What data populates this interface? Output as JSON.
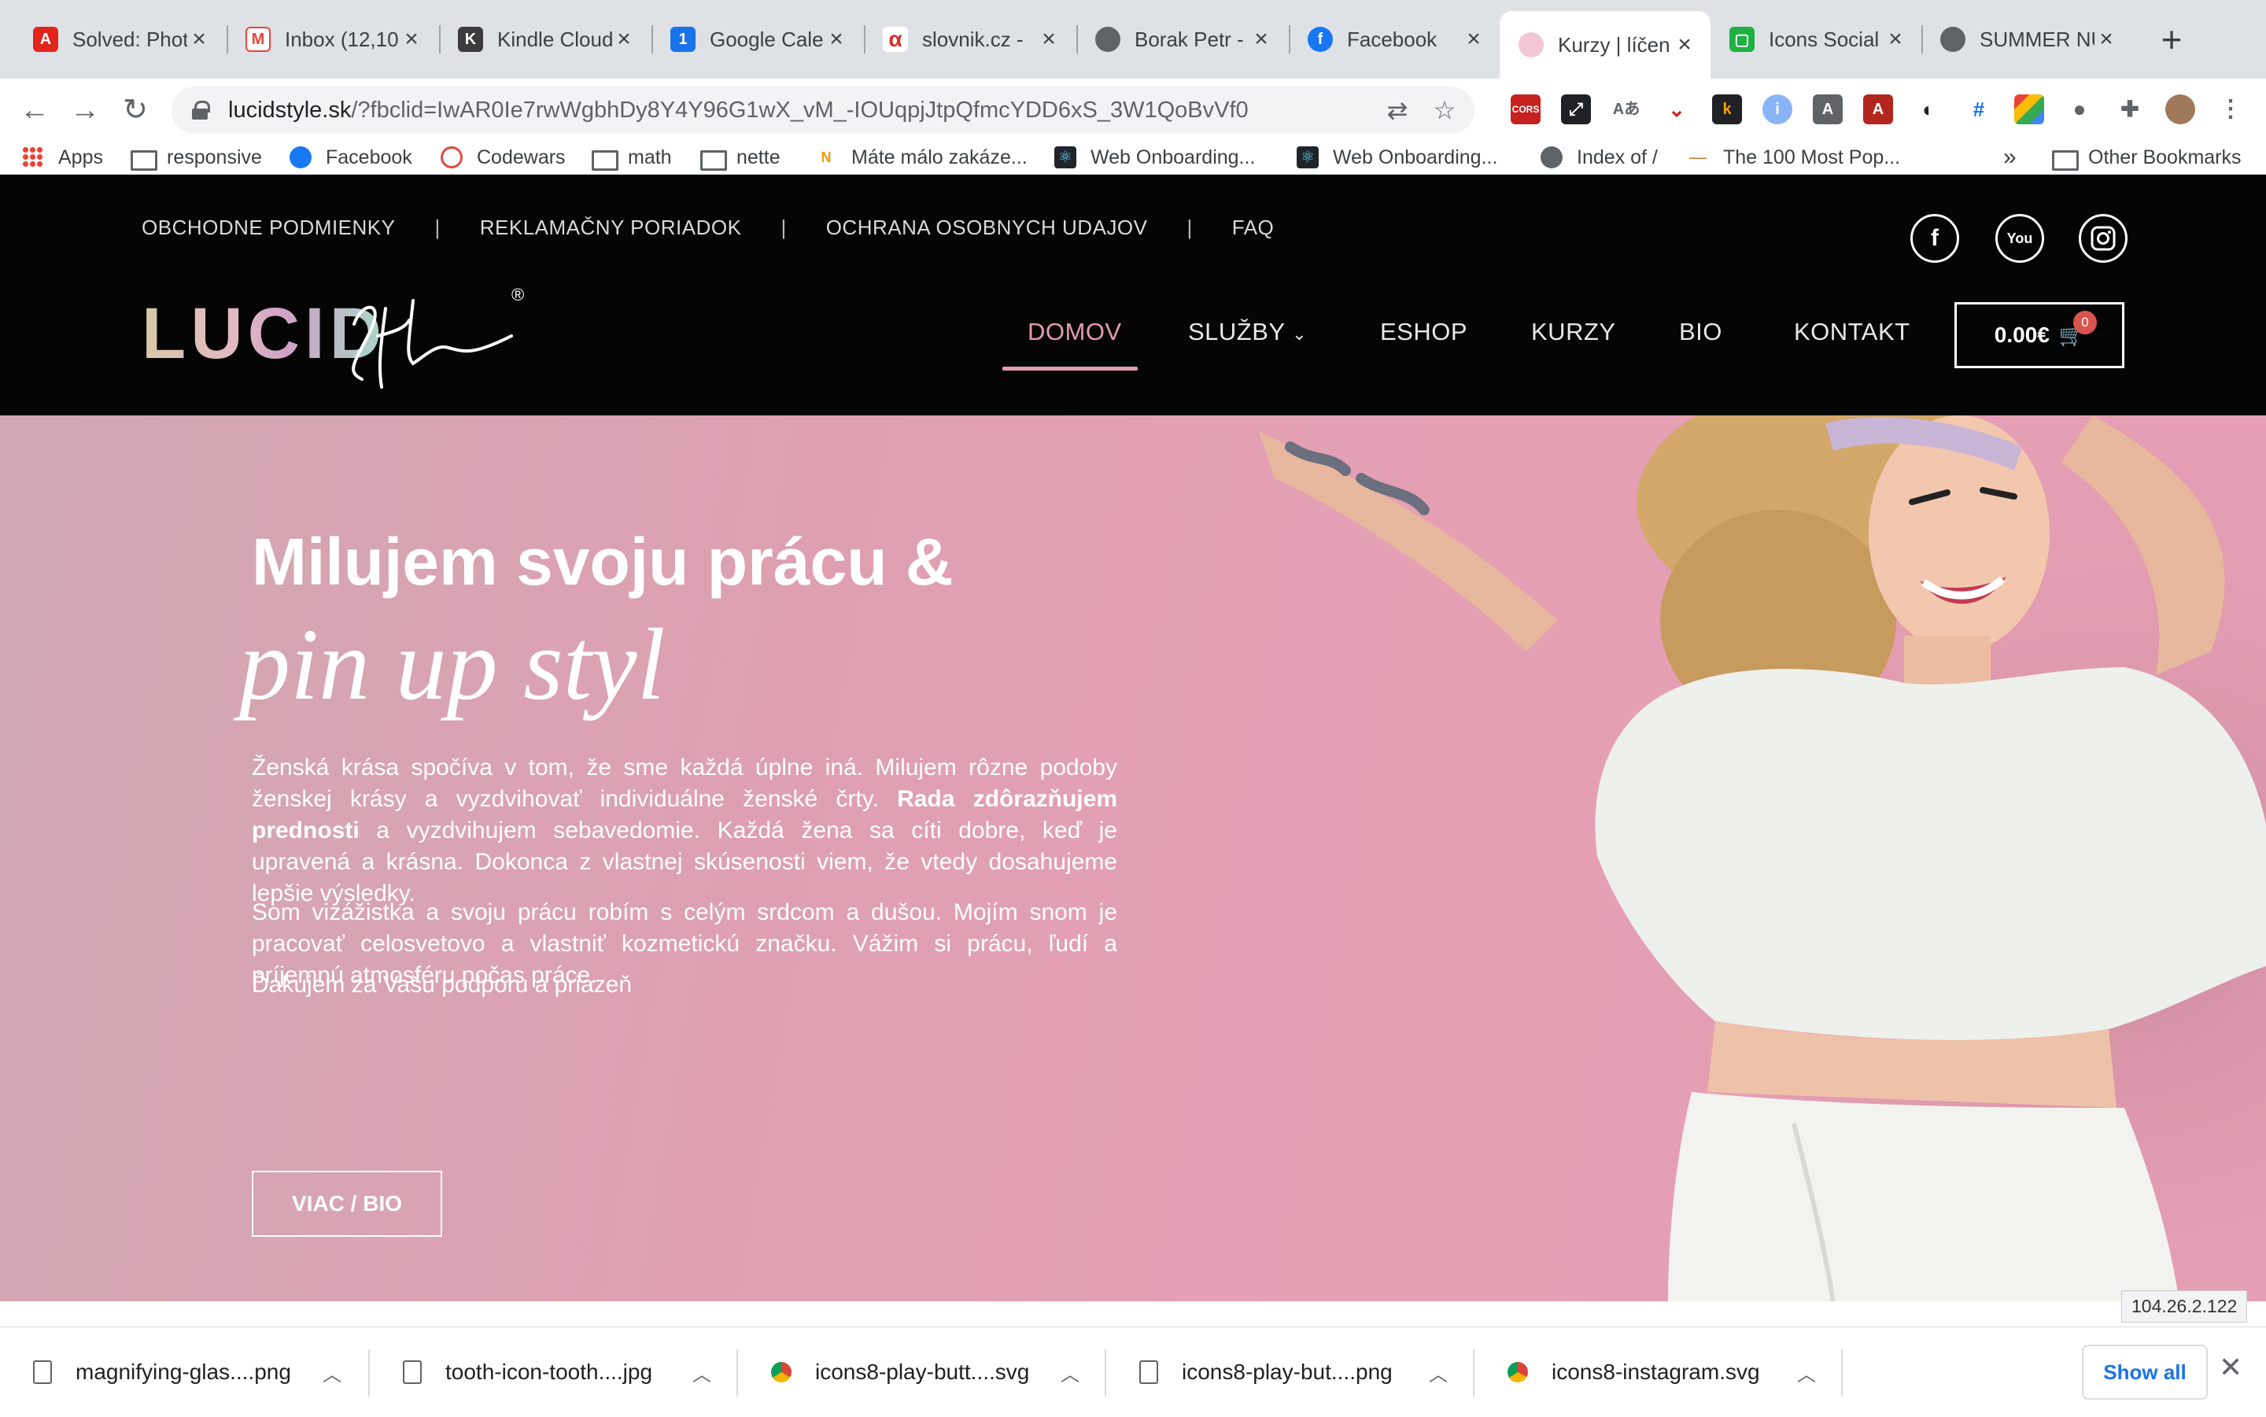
{
  "browser": {
    "tabs": [
      {
        "label": "Solved: Phot",
        "icon": "adobe-icon",
        "color": "#e1251b"
      },
      {
        "label": "Inbox (12,10",
        "icon": "gmail-icon",
        "color": "#ea4335"
      },
      {
        "label": "Kindle Cloud",
        "icon": "kindle-icon",
        "color": "#3c3c3c"
      },
      {
        "label": "Google Cale",
        "icon": "calendar-icon",
        "color": "#1a73e8"
      },
      {
        "label": "slovnik.cz - ",
        "icon": "slovnik-icon",
        "color": "#d93025"
      },
      {
        "label": "Borak Petr - ",
        "icon": "globe-icon",
        "color": "#5f6368"
      },
      {
        "label": "Facebook",
        "icon": "facebook-icon",
        "color": "#1877f2"
      },
      {
        "label": "Kurzy | líčen",
        "icon": "lucid-icon",
        "color": "#e59bb0"
      },
      {
        "label": "Icons Social",
        "icon": "icons8-icon",
        "color": "#1fb141"
      },
      {
        "label": "SUMMER NU",
        "icon": "globe-icon",
        "color": "#5f6368"
      }
    ],
    "url_main": "lucidstyle.sk",
    "url_rest": "/?fbclid=IwAR0Ie7rwWgbhDy8Y4Y96G1wX_vM_-IOUqpjJtpQfmcYDD6xS_3W1QoBvVf0",
    "bookmarks": [
      {
        "label": "Apps",
        "type": "apps"
      },
      {
        "label": "responsive",
        "type": "folder"
      },
      {
        "label": "Facebook",
        "type": "facebook"
      },
      {
        "label": "Codewars",
        "type": "codewars"
      },
      {
        "label": "math",
        "type": "folder"
      },
      {
        "label": "nette",
        "type": "folder"
      },
      {
        "label": "Máte málo zakáze...",
        "type": "site"
      },
      {
        "label": "Web Onboarding...",
        "type": "react"
      },
      {
        "label": "Web Onboarding...",
        "type": "react"
      },
      {
        "label": "Index of /",
        "type": "globe"
      },
      {
        "label": "The 100 Most Pop...",
        "type": "site"
      }
    ],
    "bookmarks_overflow": "»",
    "other_bookmarks": "Other Bookmarks"
  },
  "site": {
    "top_links": [
      "OBCHODNE PODMIENKY",
      "REKLAMAČNY PORIADOK",
      "OCHRANA OSOBNYCH UDAJOV",
      "FAQ"
    ],
    "top_sep": "|",
    "logo_text": "LUCID",
    "logo_script": "style",
    "logo_mark": "®",
    "nav": [
      "DOMOV",
      "SLUŽBY",
      "ESHOP",
      "KURZY",
      "BIO",
      "KONTAKT"
    ],
    "nav_active": "DOMOV",
    "cart_total": "0.00€",
    "cart_count": "0",
    "hero": {
      "title": "Milujem svoju prácu &",
      "script": "pin up style",
      "p1_a": "Ženská krása spočíva v tom, že sme každá úplne iná. Milujem rôzne podoby ženskej krásy a vyzdvihovať individuálne ženské črty. ",
      "p1_bold": "Rada zdôrazňujem prednosti",
      "p1_b": " a vyzdvihujem sebavedomie. Každá žena sa cíti dobre, keď je upravená a krásna. Dokonca z vlastnej skúsenosti viem, že vtedy dosahujeme lepšie výsledky.",
      "p2": "Som vizážistka a svoju prácu robím s celým srdcom a dušou. Mojím snom je pracovať celosvetovo a vlastniť kozmetickú značku. Vážim si prácu, ľudí a príjemnú atmosféru počas práce.",
      "p3": "Ďakujem za Vašu podporu a priazeň",
      "button": "VIAC / BIO"
    },
    "ip": "104.26.2.122"
  },
  "downloads": {
    "items": [
      {
        "name": "magnifying-glas....png",
        "type": "file"
      },
      {
        "name": "tooth-icon-tooth....jpg",
        "type": "file"
      },
      {
        "name": "icons8-play-butt....svg",
        "type": "chrome"
      },
      {
        "name": "icons8-play-but....png",
        "type": "file"
      },
      {
        "name": "icons8-instagram.svg",
        "type": "chrome"
      }
    ],
    "show_all": "Show all"
  },
  "colors": {
    "accent": "#e59bb0",
    "header_bg": "#050505",
    "hero_bg": "#e5a0b4"
  }
}
